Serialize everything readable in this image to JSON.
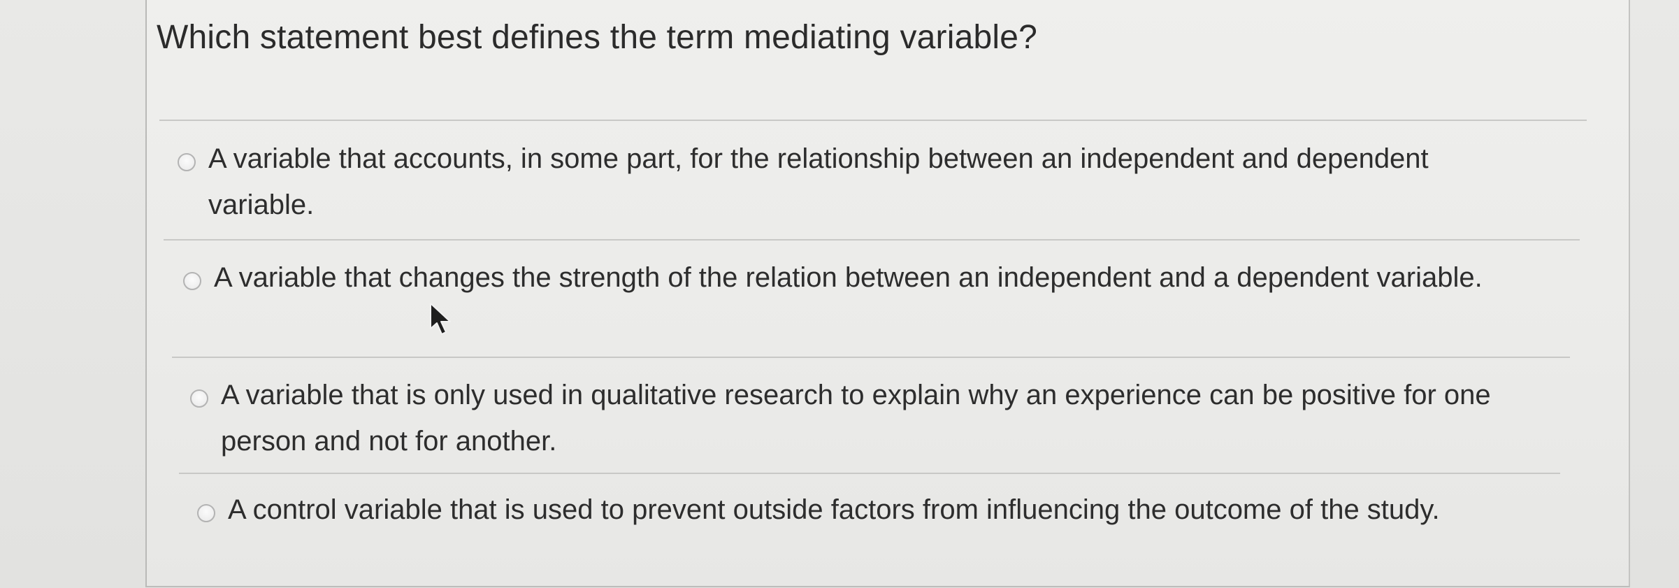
{
  "question": {
    "text": "Which statement best defines the term mediating variable?"
  },
  "options": [
    {
      "label": "A variable that accounts, in some part, for the relationship between an independent and dependent variable.",
      "selected": false
    },
    {
      "label": "A variable that changes the strength of the relation between an independent and a dependent variable.",
      "selected": false
    },
    {
      "label": "A variable that is only used in qualitative research to explain why an experience can be positive for one person and not for another.",
      "selected": false
    },
    {
      "label": "A control variable that is used to prevent outside factors from influencing the outcome of the study.",
      "selected": false
    }
  ],
  "icons": {
    "radio": "radio-button-icon",
    "pointer": "mouse-pointer-icon"
  },
  "colors": {
    "panel_background": "#efefed",
    "text": "#2d2d2d",
    "divider": "#c8c8c6",
    "radio_border": "#b3b3b3"
  }
}
